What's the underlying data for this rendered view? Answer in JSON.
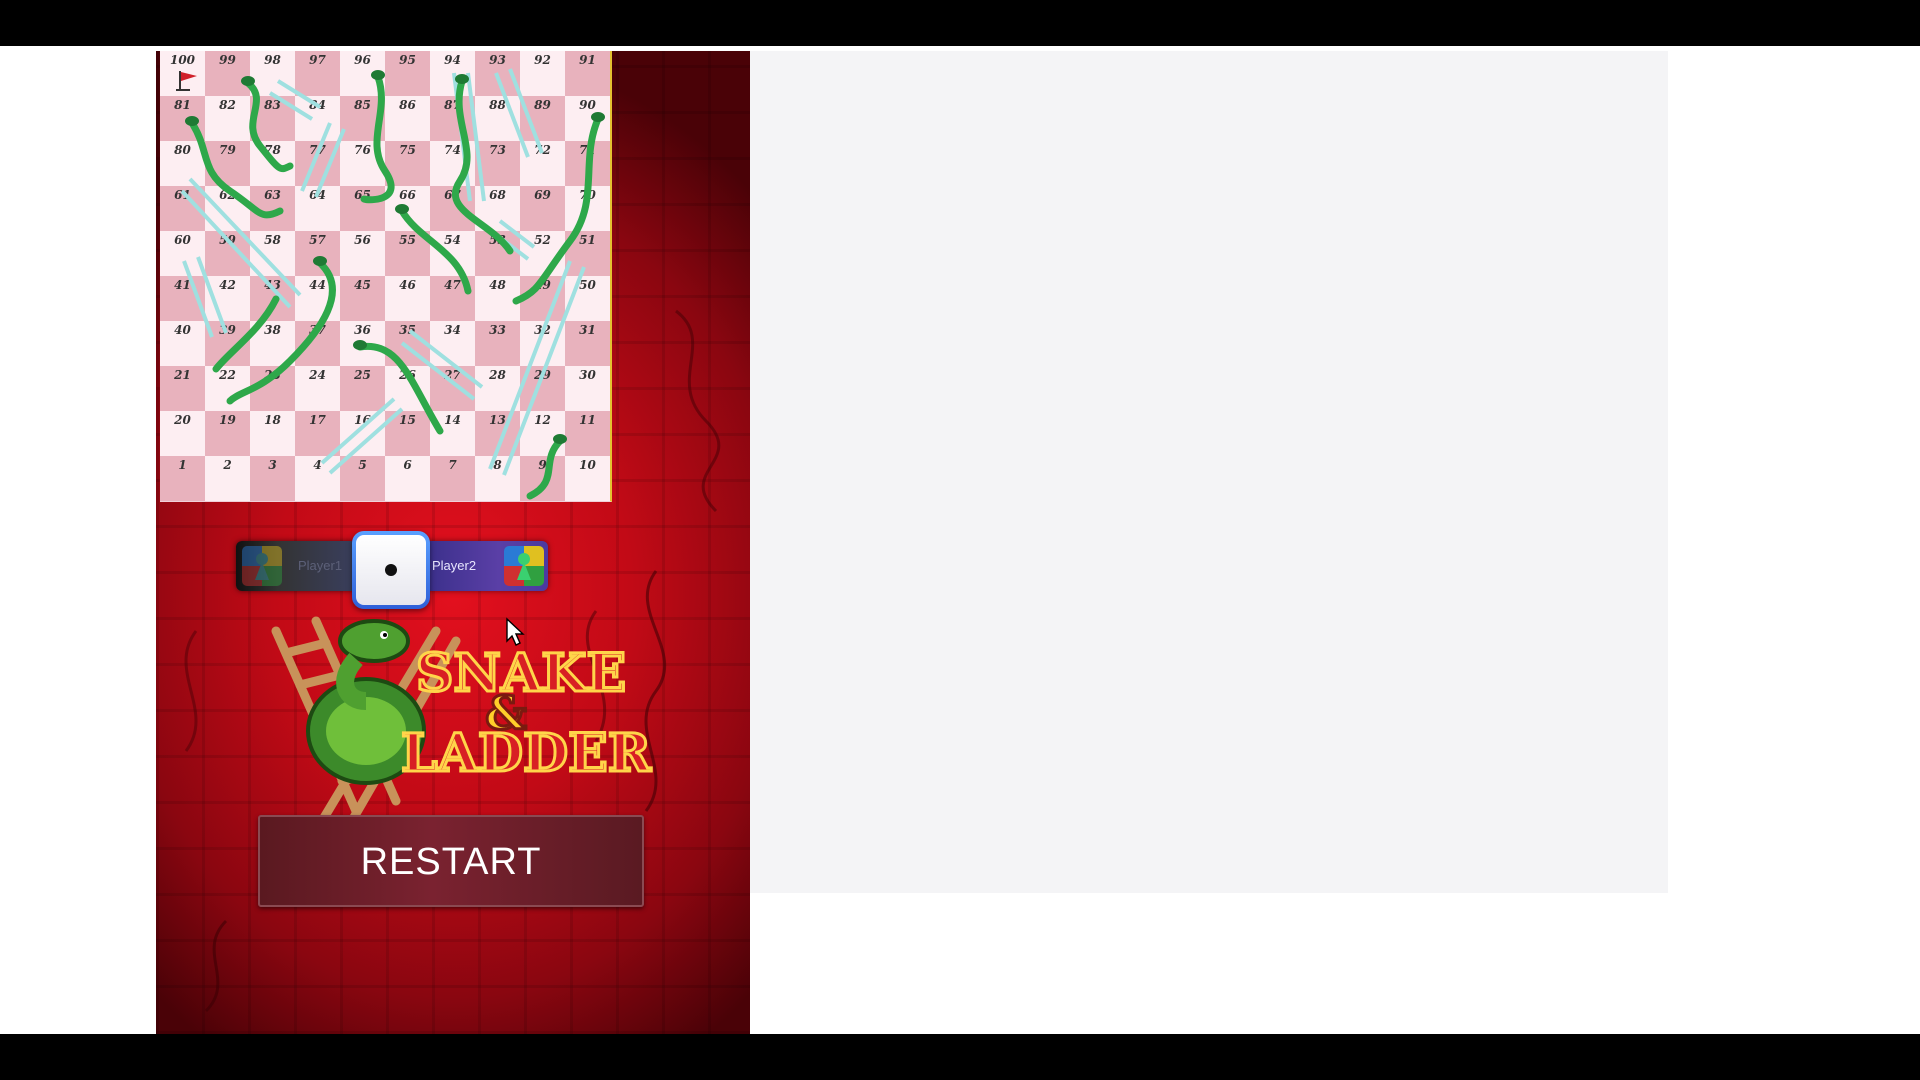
{
  "game": {
    "board": {
      "rows": [
        [
          100,
          99,
          98,
          97,
          96,
          95,
          94,
          93,
          92,
          91
        ],
        [
          81,
          82,
          83,
          84,
          85,
          86,
          87,
          88,
          89,
          90
        ],
        [
          80,
          79,
          78,
          77,
          76,
          75,
          74,
          73,
          72,
          71
        ],
        [
          61,
          62,
          63,
          64,
          65,
          66,
          67,
          68,
          69,
          70
        ],
        [
          60,
          59,
          58,
          57,
          56,
          55,
          54,
          53,
          52,
          51
        ],
        [
          41,
          42,
          43,
          44,
          45,
          46,
          47,
          48,
          49,
          50
        ],
        [
          40,
          39,
          38,
          37,
          36,
          35,
          34,
          33,
          32,
          31
        ],
        [
          21,
          22,
          23,
          24,
          25,
          26,
          27,
          28,
          29,
          30
        ],
        [
          20,
          19,
          18,
          17,
          16,
          15,
          14,
          13,
          12,
          11
        ],
        [
          1,
          2,
          3,
          4,
          5,
          6,
          7,
          8,
          9,
          10
        ]
      ],
      "snake_color": "#2ea84a",
      "ladder_color": "#9fe0e0",
      "flag_icon": "flag-icon"
    },
    "players": {
      "player1_label": "Player1",
      "player2_label": "Player2",
      "active_player": "Player2"
    },
    "dice": {
      "value": 1
    },
    "logo": {
      "line1": "SNAKE",
      "line2": "&",
      "line3": "LADDER"
    },
    "restart_label": "RESTART"
  },
  "colors": {
    "background_red": "#c20a16",
    "board_pink": "#e8b2bd",
    "board_light": "#fdeef2",
    "panel_gray": "#f4f4f6"
  }
}
